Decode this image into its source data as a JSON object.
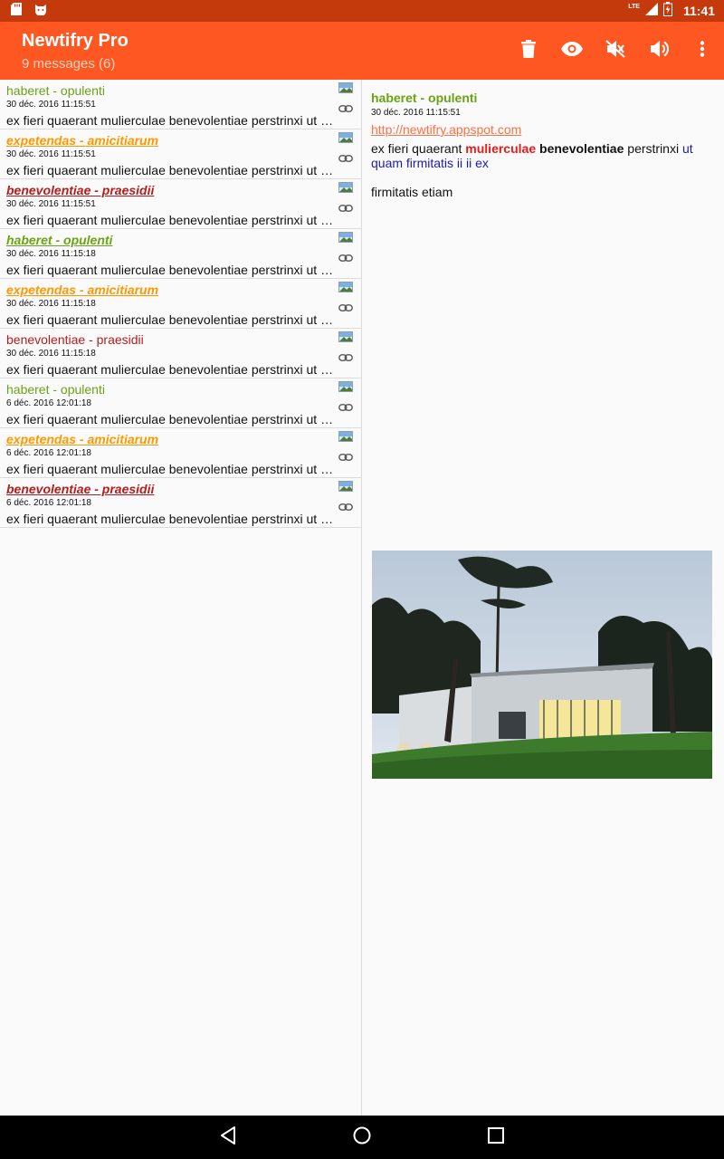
{
  "status_bar": {
    "time": "11:41",
    "network": "LTE"
  },
  "app_bar": {
    "title": "Newtifry Pro",
    "subtitle": "9 messages (6)",
    "actions": [
      "delete-icon",
      "eye-icon",
      "mute-icon",
      "volume-icon",
      "more-vert-icon"
    ]
  },
  "colors": {
    "primary": "#ff5722",
    "status": "#c43a0c",
    "green": "#6aa313",
    "orange": "#ff9800",
    "red": "#b71c1c"
  },
  "messages": [
    {
      "subject": "haberet - opulenti",
      "date": "30 déc. 2016 11:15:51",
      "preview": "ex fieri quaerant mulierculae benevolentiae perstrinxi ut q...",
      "color": "#6aa313",
      "unread": false
    },
    {
      "subject": "expetendas - amicitiarum",
      "date": "30 déc. 2016 11:15:51",
      "preview": "ex fieri quaerant mulierculae benevolentiae perstrinxi ut q...",
      "color": "#ff9800",
      "unread": true
    },
    {
      "subject": "benevolentiae - praesidii",
      "date": "30 déc. 2016 11:15:51",
      "preview": "ex fieri quaerant mulierculae benevolentiae perstrinxi ut q...",
      "color": "#b71c1c",
      "unread": true
    },
    {
      "subject": "haberet - opulenti",
      "date": "30 déc. 2016 11:15:18",
      "preview": "ex fieri quaerant mulierculae benevolentiae perstrinxi ut q...",
      "color": "#6aa313",
      "unread": true
    },
    {
      "subject": "expetendas - amicitiarum",
      "date": "30 déc. 2016 11:15:18",
      "preview": "ex fieri quaerant mulierculae benevolentiae perstrinxi ut q...",
      "color": "#ff9800",
      "unread": true
    },
    {
      "subject": "benevolentiae - praesidii",
      "date": "30 déc. 2016 11:15:18",
      "preview": "ex fieri quaerant mulierculae benevolentiae perstrinxi ut q...",
      "color": "#b71c1c",
      "unread": false
    },
    {
      "subject": "haberet - opulenti",
      "date": "6 déc. 2016 12:01:18",
      "preview": "ex fieri quaerant mulierculae benevolentiae perstrinxi ut q...",
      "color": "#6aa313",
      "unread": false
    },
    {
      "subject": "expetendas - amicitiarum",
      "date": "6 déc. 2016 12:01:18",
      "preview": "ex fieri quaerant mulierculae benevolentiae perstrinxi ut q...",
      "color": "#ff9800",
      "unread": true
    },
    {
      "subject": "benevolentiae - praesidii",
      "date": "6 déc. 2016 12:01:18",
      "preview": "ex fieri quaerant mulierculae benevolentiae perstrinxi ut q...",
      "color": "#b71c1c",
      "unread": true
    }
  ],
  "detail": {
    "subject": "haberet - opulenti",
    "date": "30 déc. 2016 11:15:51",
    "link": "http://newtifry.appspot.com",
    "body_plain_1": "ex fieri quaerant ",
    "body_red": "mulierculae",
    "body_bold": "benevolentiae",
    "body_plain_2": " perstrinxi ",
    "body_blue": "ut quam firmitatis ii ii ex",
    "body_second": "firmitatis etiam"
  }
}
